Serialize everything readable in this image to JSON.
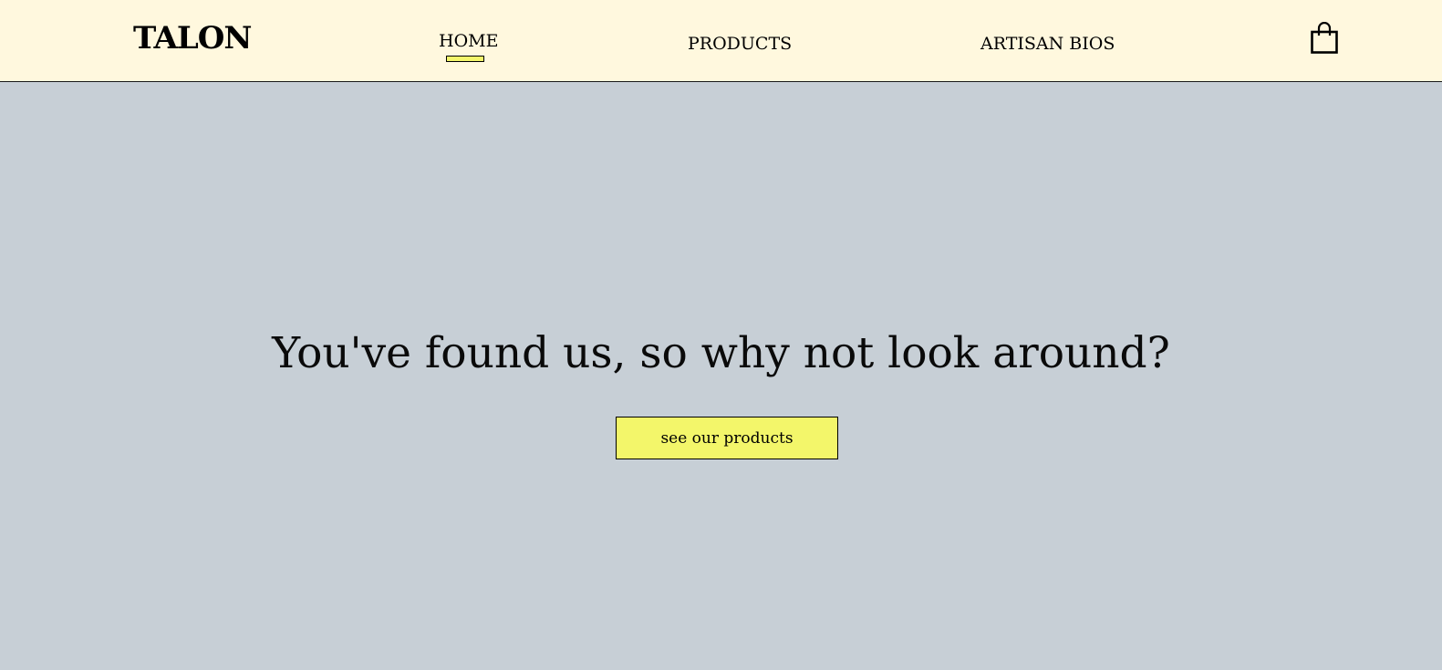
{
  "header": {
    "logo": "TALON",
    "nav": {
      "home": "HOME",
      "products": "PRODUCTS",
      "artisan_bios": "ARTISAN BIOS"
    },
    "active_nav": "home",
    "cart_icon": "shopping-bag-icon"
  },
  "hero": {
    "headline": "You've found us, so why not look around?",
    "cta_label": "see our products"
  },
  "colors": {
    "header_bg": "#fff8de",
    "hero_bg": "#c7cfd6",
    "accent": "#f3f66a",
    "text": "#000000"
  }
}
